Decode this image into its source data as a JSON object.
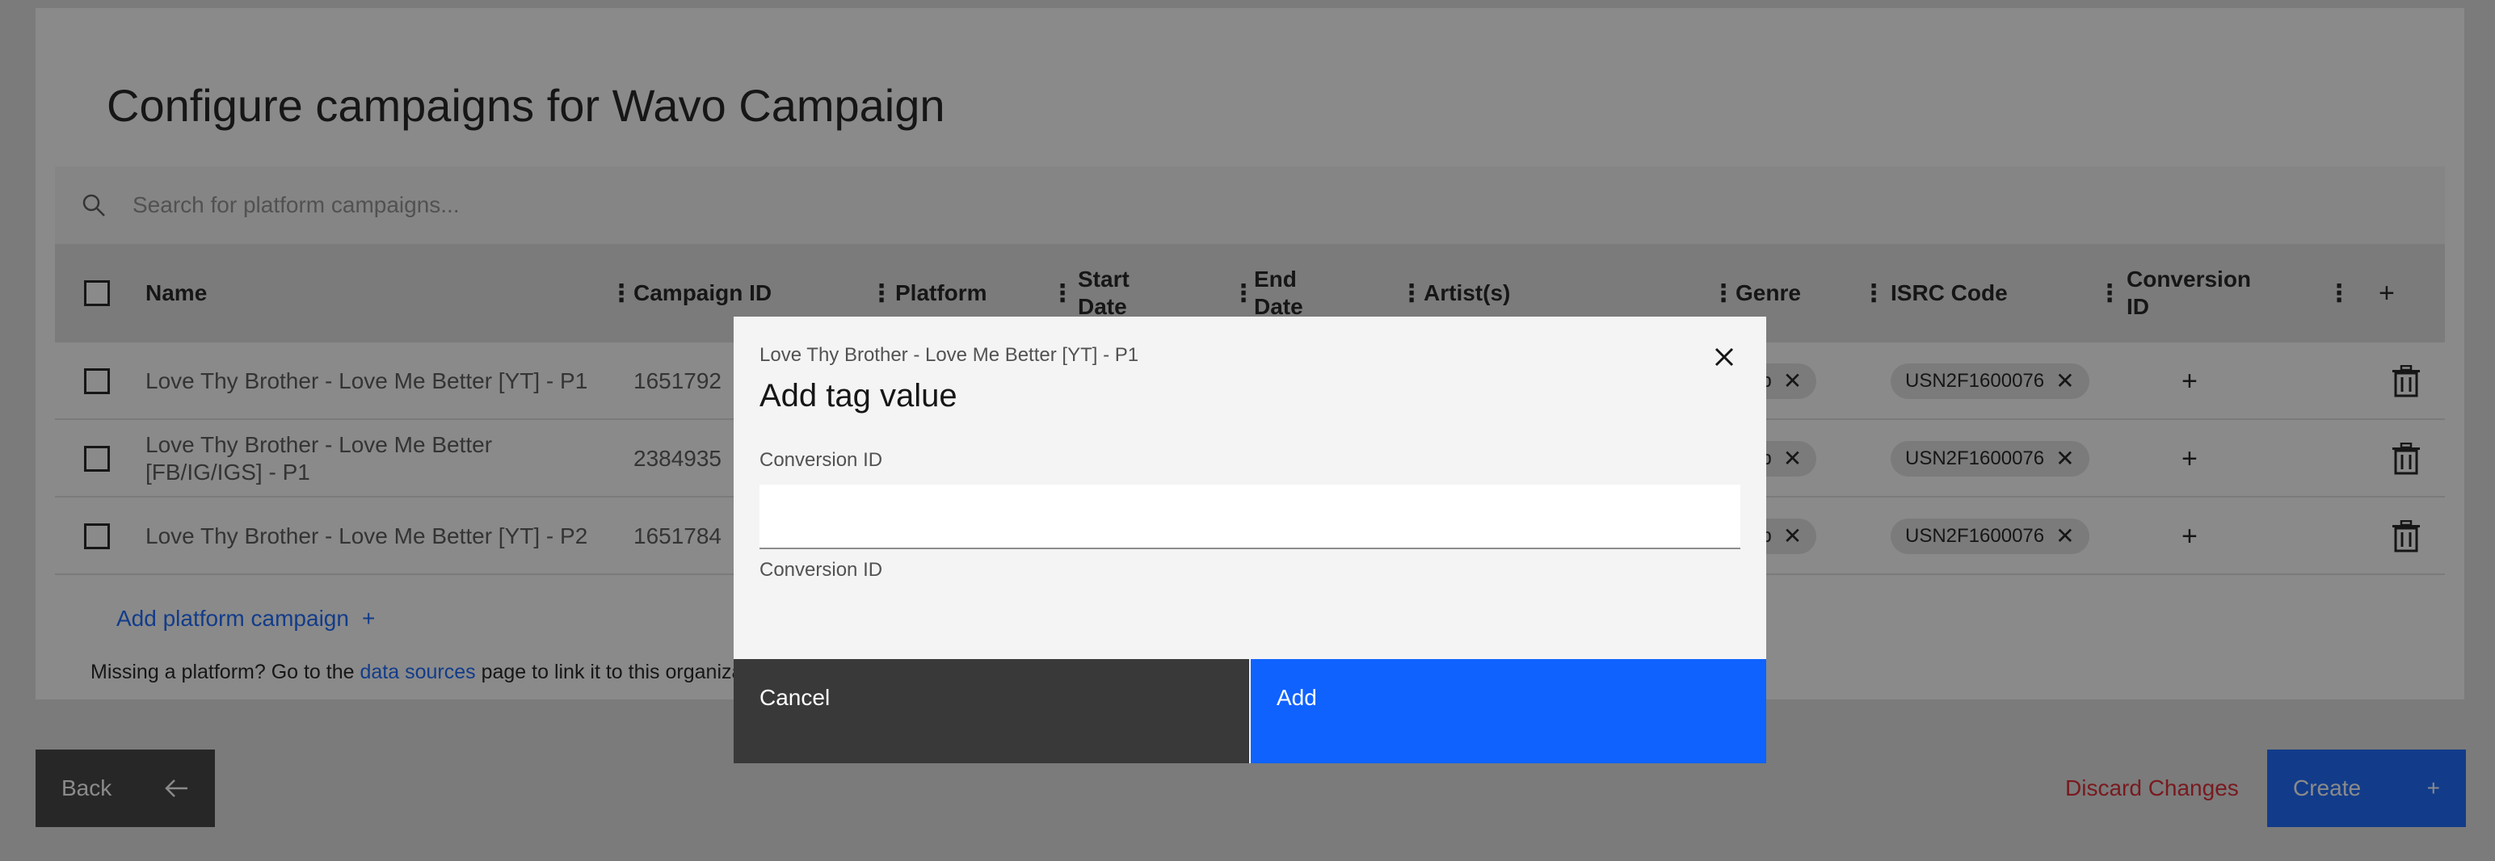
{
  "page": {
    "title": "Configure campaigns for Wavo Campaign"
  },
  "search": {
    "placeholder": "Search for platform campaigns..."
  },
  "table": {
    "columns": {
      "name": "Name",
      "campaign_id": "Campaign ID",
      "platform": "Platform",
      "start_date_1": "Start",
      "start_date_2": "Date",
      "end_date_1": "End",
      "end_date_2": "Date",
      "artists": "Artist(s)",
      "genre": "Genre",
      "isrc": "ISRC Code",
      "conversion_1": "Conversion",
      "conversion_2": "ID",
      "add_column": "+"
    },
    "rows": [
      {
        "name_1": "Love Thy Brother - Love Me Better [YT] - P1",
        "name_2": "",
        "campaign_id": "1651792",
        "genre": "op",
        "isrc": "USN2F1600076",
        "add": "+"
      },
      {
        "name_1": "Love Thy Brother - Love Me Better",
        "name_2": "[FB/IG/IGS] - P1",
        "campaign_id": "2384935",
        "genre": "op",
        "isrc": "USN2F1600076",
        "add": "+"
      },
      {
        "name_1": "Love Thy Brother - Love Me Better [YT] - P2",
        "name_2": "",
        "campaign_id": "1651784",
        "genre": "op",
        "isrc": "USN2F1600076",
        "add": "+"
      }
    ]
  },
  "add_platform_campaign": "Add platform campaign",
  "add_plus": "+",
  "missing": {
    "prefix": "Missing a platform? Go to the",
    "link": "data sources",
    "suffix": "page to link it to this organizati"
  },
  "footer": {
    "back": "Back",
    "discard": "Discard Changes",
    "create": "Create",
    "create_plus": "+"
  },
  "modal": {
    "label": "Love Thy Brother - Love Me Better [YT] - P1",
    "heading": "Add tag value",
    "field_label": "Conversion ID",
    "field_value": "",
    "helper": "Conversion ID",
    "cancel": "Cancel",
    "add": "Add"
  },
  "colors": {
    "primary": "#0f62fe",
    "danger": "#da1e28",
    "dark": "#393939"
  }
}
